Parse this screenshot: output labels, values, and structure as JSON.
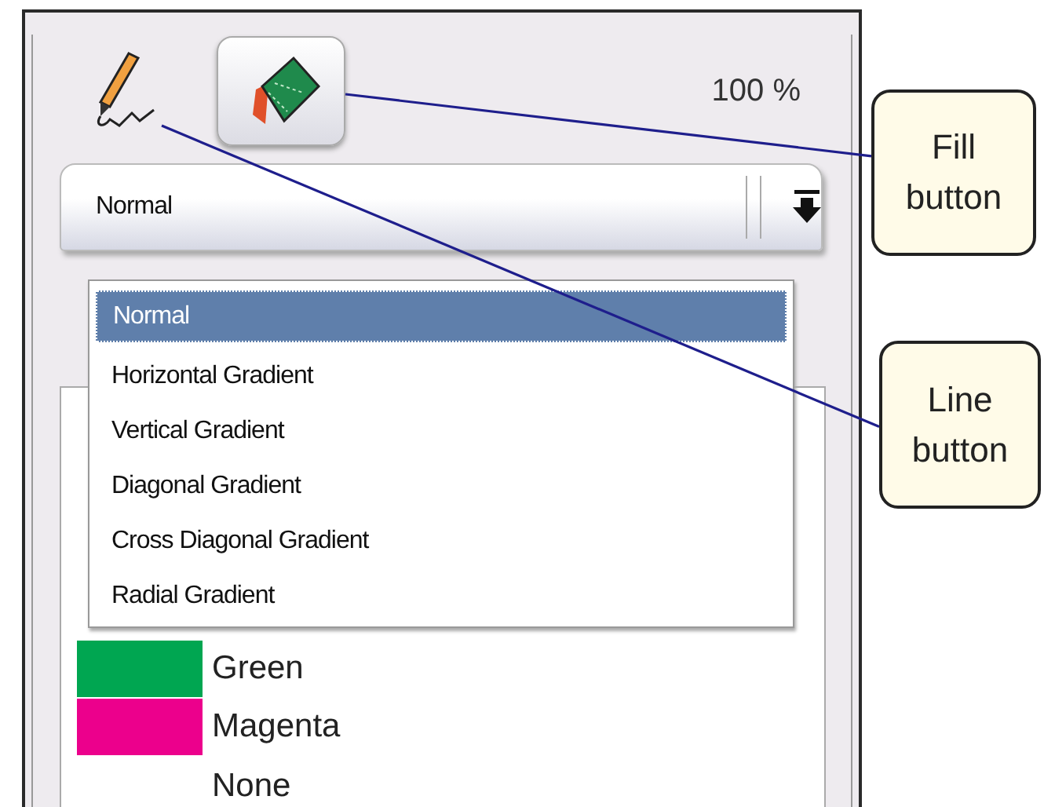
{
  "tools": [
    {
      "kind": "line",
      "selected": false
    },
    {
      "kind": "fill",
      "selected": true
    }
  ],
  "zoom": "100 %",
  "fill_style": {
    "value": "Normal",
    "expanded": true,
    "options": [
      {
        "label": "Normal",
        "selected": true
      },
      {
        "label": "Horizontal Gradient",
        "selected": false
      },
      {
        "label": "Vertical Gradient",
        "selected": false
      },
      {
        "label": "Diagonal Gradient",
        "selected": false
      },
      {
        "label": "Cross Diagonal Gradient",
        "selected": false
      },
      {
        "label": "Radial Gradient",
        "selected": false
      }
    ]
  },
  "colors": [
    {
      "name": "Green",
      "color": "#00a651"
    },
    {
      "name": "Magenta",
      "color": "#ec008c"
    },
    {
      "name": "None"
    }
  ],
  "callouts": [
    {
      "text": "Fill button",
      "kind": "fill"
    },
    {
      "text": "Line button",
      "kind": "line"
    }
  ]
}
